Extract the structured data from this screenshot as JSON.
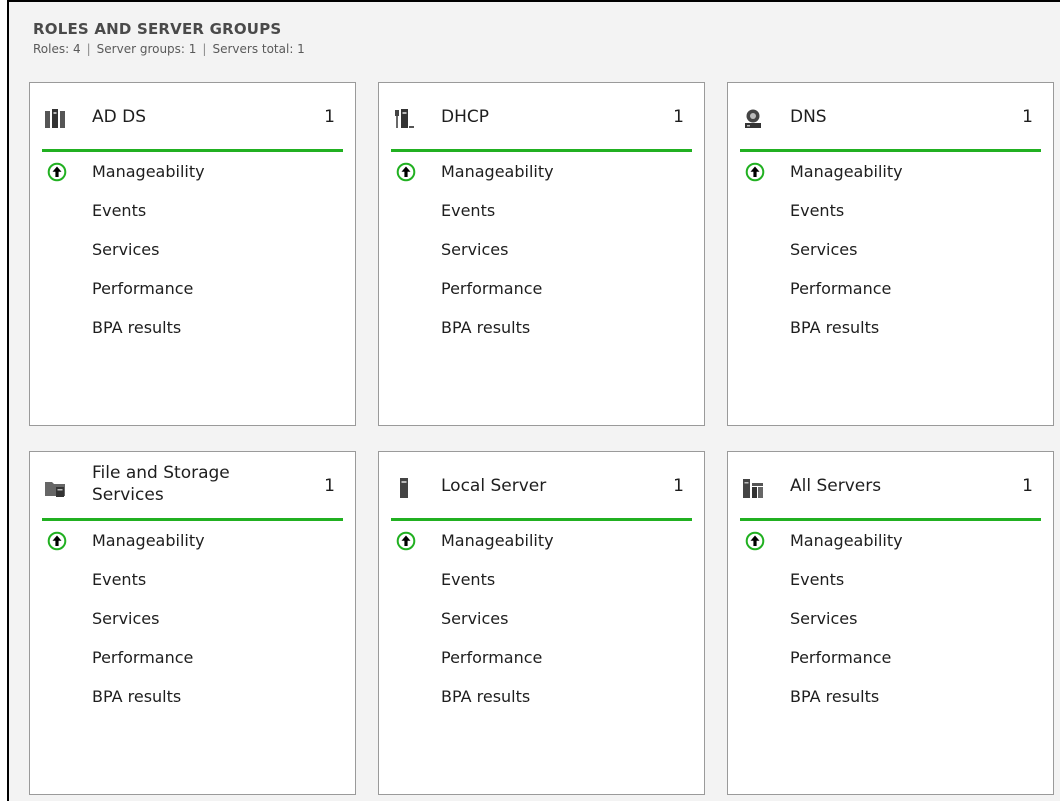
{
  "header": {
    "title": "ROLES AND SERVER GROUPS",
    "roles": "Roles: 4",
    "server_groups": "Server groups: 1",
    "servers_total": "Servers total: 1",
    "separator": "|"
  },
  "accent_color": "#21b021",
  "tiles": [
    {
      "title": "AD DS",
      "count": "1",
      "icon": "ad-ds-icon",
      "rows": [
        "Manageability",
        "Events",
        "Services",
        "Performance",
        "BPA results"
      ]
    },
    {
      "title": "DHCP",
      "count": "1",
      "icon": "dhcp-icon",
      "rows": [
        "Manageability",
        "Events",
        "Services",
        "Performance",
        "BPA results"
      ]
    },
    {
      "title": "DNS",
      "count": "1",
      "icon": "dns-icon",
      "rows": [
        "Manageability",
        "Events",
        "Services",
        "Performance",
        "BPA results"
      ]
    },
    {
      "title": "File and Storage Services",
      "count": "1",
      "icon": "file-storage-icon",
      "rows": [
        "Manageability",
        "Events",
        "Services",
        "Performance",
        "BPA results"
      ]
    },
    {
      "title": "Local Server",
      "count": "1",
      "icon": "local-server-icon",
      "rows": [
        "Manageability",
        "Events",
        "Services",
        "Performance",
        "BPA results"
      ]
    },
    {
      "title": "All Servers",
      "count": "1",
      "icon": "all-servers-icon",
      "rows": [
        "Manageability",
        "Events",
        "Services",
        "Performance",
        "BPA results"
      ]
    }
  ]
}
